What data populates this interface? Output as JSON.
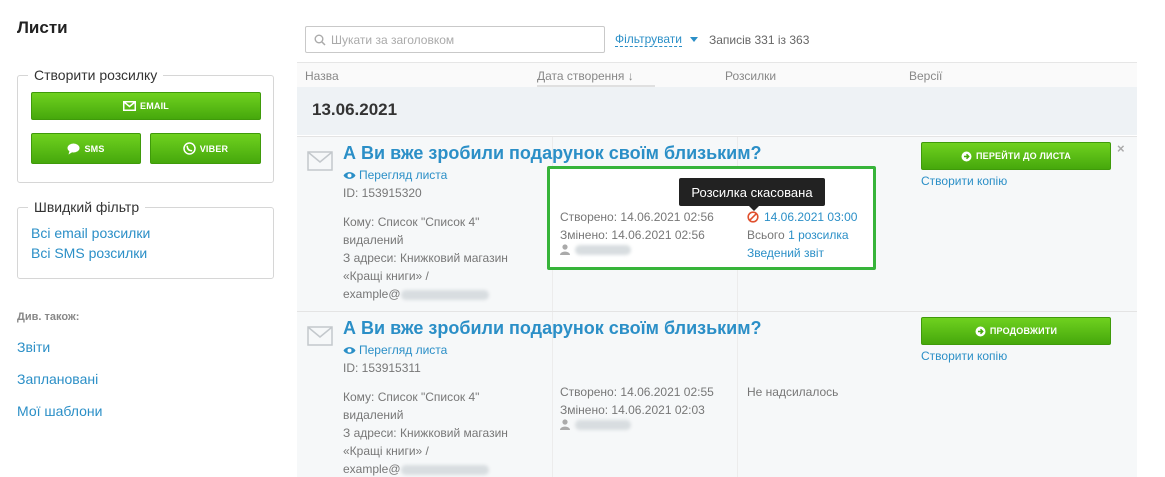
{
  "page": {
    "title": "Листи"
  },
  "sidebar": {
    "create": {
      "legend": "Створити розсилку",
      "email_label": "Email",
      "sms_label": "SMS",
      "viber_label": "Viber"
    },
    "quick_filter": {
      "legend": "Швидкий фільтр",
      "links": [
        "Всі email розсилки",
        "Всі SMS розсилки"
      ]
    },
    "see_also": {
      "label": "Див. також:",
      "links": [
        "Звіти",
        "Заплановані",
        "Мої шаблони"
      ]
    }
  },
  "toolbar": {
    "search_placeholder": "Шукати за заголовком",
    "search_value": "",
    "filter_label": "Фільтрувати",
    "records": "Записів 331 із 363"
  },
  "columns": {
    "name": "Назва",
    "date": "Дата створення ↓",
    "sends": "Розсилки",
    "versions": "Версії"
  },
  "group_date": "13.06.2021",
  "tooltip": "Розсилка скасована",
  "rows": [
    {
      "title": "А Ви вже зробили подарунок своїм близьким?",
      "preview": "Перегляд листа",
      "id": "ID: 153915320",
      "to_line": "Кому: Список \"Список 4\"",
      "to_deleted": "видалений",
      "from_line": "З адреси: Книжковий магазин",
      "from_name": "«Кращі книги» /",
      "from_email": "example@",
      "created": "Створено: 14.06.2021 02:56",
      "modified": "Змінено: 14.06.2021 02:56",
      "send_date": "14.06.2021 03:00",
      "send_total_prefix": "Всього",
      "send_total_link": "1 розсилка",
      "send_report": "Зведений звіт",
      "action_label": "Перейти до листа",
      "copy_label": "Створити копію",
      "close_label": "×"
    },
    {
      "title": "А Ви вже зробили подарунок своїм близьким?",
      "preview": "Перегляд листа",
      "id": "ID: 153915311",
      "to_line": "Кому: Список \"Список 4\"",
      "to_deleted": "видалений",
      "from_line": "З адреси: Книжковий магазин",
      "from_name": "«Кращі книги» /",
      "from_email": "example@",
      "created": "Створено: 14.06.2021 02:55",
      "modified": "Змінено: 14.06.2021 02:03",
      "send_status": "Не надсилалось",
      "action_label": "Продовжити",
      "copy_label": "Створити копію"
    }
  ],
  "colors": {
    "accent": "#2b8fc7",
    "button_green": "#4caf0f",
    "highlight": "#37b43a",
    "cancel_icon": "#e0502e"
  }
}
